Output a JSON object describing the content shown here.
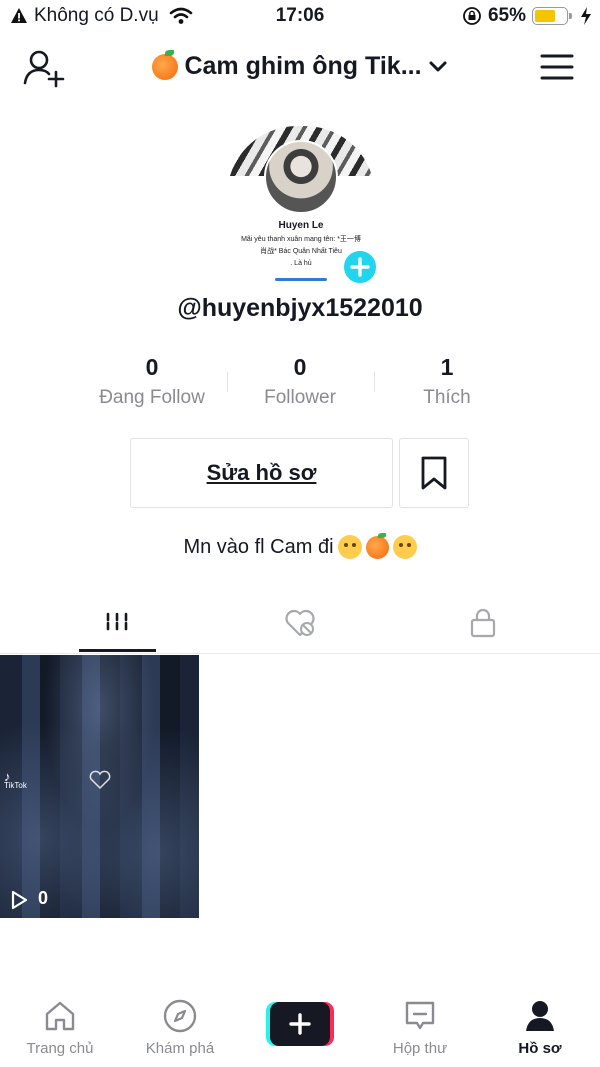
{
  "status_bar": {
    "carrier": "Không có D.vụ",
    "time": "17:06",
    "battery_percent": "65%",
    "battery_level": 0.65
  },
  "header": {
    "title": "Cam ghim ông Tik...",
    "icons": [
      "add-user-icon",
      "chevron-down-icon",
      "menu-icon"
    ]
  },
  "profile": {
    "card_name": "Huyen Le",
    "card_bio_line1": "Mãi yêu thanh xuân mang tên: *王一博",
    "card_bio_line2": "肖战* Bác Quân Nhất Tiêu",
    "card_bio_line3": ". Là hủ",
    "username": "@huyenbjyx1522010",
    "stats": [
      {
        "value": "0",
        "label": "Đang Follow"
      },
      {
        "value": "0",
        "label": "Follower"
      },
      {
        "value": "1",
        "label": "Thích"
      }
    ],
    "edit_label": "Sửa hồ sơ",
    "bio": "Mn vào fl Cam đi"
  },
  "tabs": [
    {
      "name": "videos",
      "icon": "grid-icon",
      "active": true
    },
    {
      "name": "liked",
      "icon": "hidden-heart-icon",
      "active": false
    },
    {
      "name": "private",
      "icon": "lock-icon",
      "active": false
    }
  ],
  "videos": [
    {
      "views": "0",
      "watermark": "TikTok"
    }
  ],
  "bottom_nav": {
    "home": "Trang chủ",
    "discover": "Khám phá",
    "inbox": "Hộp thư",
    "profile": "Hồ sơ"
  },
  "colors": {
    "accent_cyan": "#25f4ee",
    "accent_red": "#fe2c55",
    "add_avatar": "#20d5ec",
    "text": "#161823",
    "muted": "#8a8b91"
  }
}
